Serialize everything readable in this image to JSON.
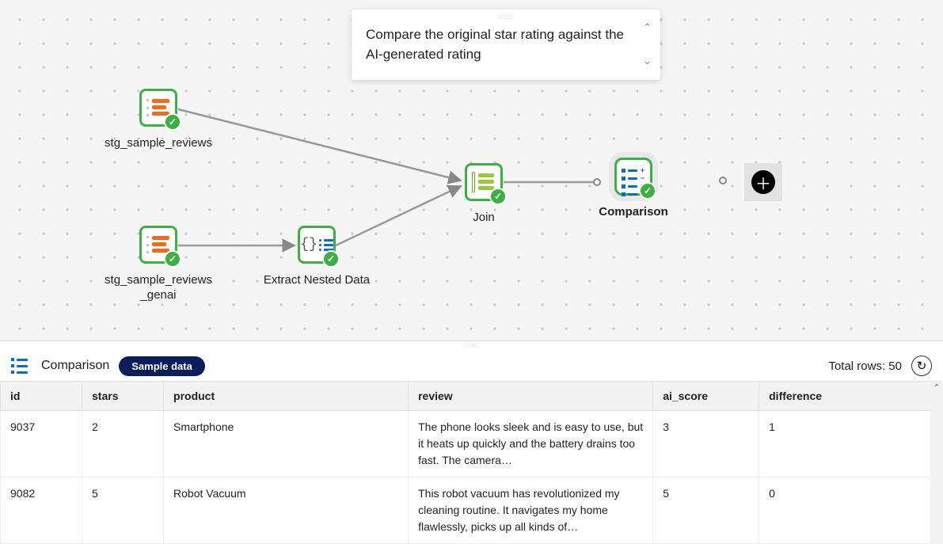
{
  "tooltip": {
    "text": "Compare the original star rating against the AI-generated rating"
  },
  "nodes": {
    "src1": {
      "label": "stg_sample_reviews"
    },
    "src2": {
      "label": "stg_sample_reviews_genai",
      "label_l1": "stg_sample_reviews",
      "label_l2": "_genai"
    },
    "extract": {
      "label": "Extract Nested Data"
    },
    "join": {
      "label": "Join"
    },
    "comparison": {
      "label": "Comparison"
    }
  },
  "panel": {
    "title": "Comparison",
    "badge": "Sample data",
    "total_rows_label": "Total rows: 50"
  },
  "table": {
    "headers": {
      "id": "id",
      "stars": "stars",
      "product": "product",
      "review": "review",
      "ai_score": "ai_score",
      "difference": "difference"
    },
    "rows": [
      {
        "id": "9037",
        "stars": "2",
        "product": "Smartphone",
        "review": "The phone looks sleek and is easy to use, but it heats up quickly and the battery drains too fast. The camera…",
        "ai_score": "3",
        "difference": "1"
      },
      {
        "id": "9082",
        "stars": "5",
        "product": "Robot Vacuum",
        "review": "This robot vacuum has revolutionized my cleaning routine. It navigates my home flawlessly, picks up all kinds of…",
        "ai_score": "5",
        "difference": "0"
      }
    ]
  }
}
